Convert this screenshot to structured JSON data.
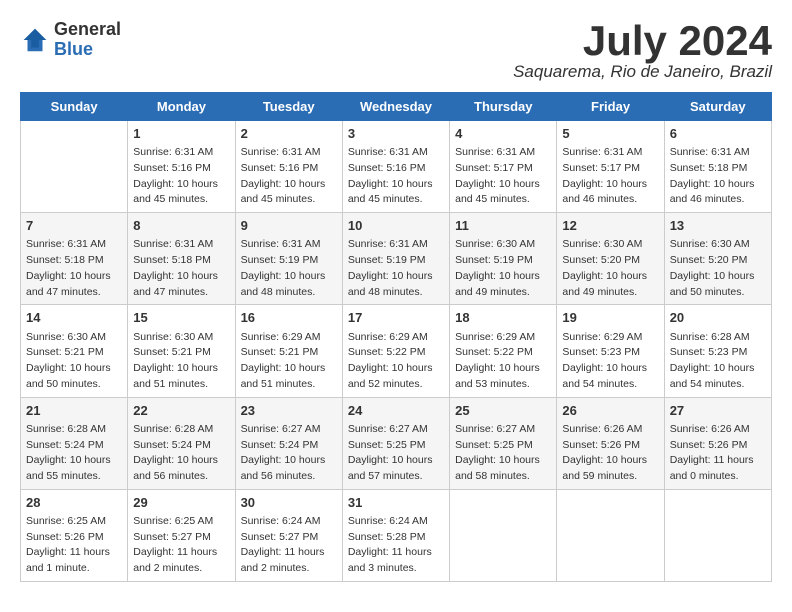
{
  "logo": {
    "general": "General",
    "blue": "Blue"
  },
  "title": "July 2024",
  "location": "Saquarema, Rio de Janeiro, Brazil",
  "days_of_week": [
    "Sunday",
    "Monday",
    "Tuesday",
    "Wednesday",
    "Thursday",
    "Friday",
    "Saturday"
  ],
  "weeks": [
    [
      {
        "day": "",
        "sunrise": "",
        "sunset": "",
        "daylight": ""
      },
      {
        "day": "1",
        "sunrise": "Sunrise: 6:31 AM",
        "sunset": "Sunset: 5:16 PM",
        "daylight": "Daylight: 10 hours and 45 minutes."
      },
      {
        "day": "2",
        "sunrise": "Sunrise: 6:31 AM",
        "sunset": "Sunset: 5:16 PM",
        "daylight": "Daylight: 10 hours and 45 minutes."
      },
      {
        "day": "3",
        "sunrise": "Sunrise: 6:31 AM",
        "sunset": "Sunset: 5:16 PM",
        "daylight": "Daylight: 10 hours and 45 minutes."
      },
      {
        "day": "4",
        "sunrise": "Sunrise: 6:31 AM",
        "sunset": "Sunset: 5:17 PM",
        "daylight": "Daylight: 10 hours and 45 minutes."
      },
      {
        "day": "5",
        "sunrise": "Sunrise: 6:31 AM",
        "sunset": "Sunset: 5:17 PM",
        "daylight": "Daylight: 10 hours and 46 minutes."
      },
      {
        "day": "6",
        "sunrise": "Sunrise: 6:31 AM",
        "sunset": "Sunset: 5:18 PM",
        "daylight": "Daylight: 10 hours and 46 minutes."
      }
    ],
    [
      {
        "day": "7",
        "sunrise": "Sunrise: 6:31 AM",
        "sunset": "Sunset: 5:18 PM",
        "daylight": "Daylight: 10 hours and 47 minutes."
      },
      {
        "day": "8",
        "sunrise": "Sunrise: 6:31 AM",
        "sunset": "Sunset: 5:18 PM",
        "daylight": "Daylight: 10 hours and 47 minutes."
      },
      {
        "day": "9",
        "sunrise": "Sunrise: 6:31 AM",
        "sunset": "Sunset: 5:19 PM",
        "daylight": "Daylight: 10 hours and 48 minutes."
      },
      {
        "day": "10",
        "sunrise": "Sunrise: 6:31 AM",
        "sunset": "Sunset: 5:19 PM",
        "daylight": "Daylight: 10 hours and 48 minutes."
      },
      {
        "day": "11",
        "sunrise": "Sunrise: 6:30 AM",
        "sunset": "Sunset: 5:19 PM",
        "daylight": "Daylight: 10 hours and 49 minutes."
      },
      {
        "day": "12",
        "sunrise": "Sunrise: 6:30 AM",
        "sunset": "Sunset: 5:20 PM",
        "daylight": "Daylight: 10 hours and 49 minutes."
      },
      {
        "day": "13",
        "sunrise": "Sunrise: 6:30 AM",
        "sunset": "Sunset: 5:20 PM",
        "daylight": "Daylight: 10 hours and 50 minutes."
      }
    ],
    [
      {
        "day": "14",
        "sunrise": "Sunrise: 6:30 AM",
        "sunset": "Sunset: 5:21 PM",
        "daylight": "Daylight: 10 hours and 50 minutes."
      },
      {
        "day": "15",
        "sunrise": "Sunrise: 6:30 AM",
        "sunset": "Sunset: 5:21 PM",
        "daylight": "Daylight: 10 hours and 51 minutes."
      },
      {
        "day": "16",
        "sunrise": "Sunrise: 6:29 AM",
        "sunset": "Sunset: 5:21 PM",
        "daylight": "Daylight: 10 hours and 51 minutes."
      },
      {
        "day": "17",
        "sunrise": "Sunrise: 6:29 AM",
        "sunset": "Sunset: 5:22 PM",
        "daylight": "Daylight: 10 hours and 52 minutes."
      },
      {
        "day": "18",
        "sunrise": "Sunrise: 6:29 AM",
        "sunset": "Sunset: 5:22 PM",
        "daylight": "Daylight: 10 hours and 53 minutes."
      },
      {
        "day": "19",
        "sunrise": "Sunrise: 6:29 AM",
        "sunset": "Sunset: 5:23 PM",
        "daylight": "Daylight: 10 hours and 54 minutes."
      },
      {
        "day": "20",
        "sunrise": "Sunrise: 6:28 AM",
        "sunset": "Sunset: 5:23 PM",
        "daylight": "Daylight: 10 hours and 54 minutes."
      }
    ],
    [
      {
        "day": "21",
        "sunrise": "Sunrise: 6:28 AM",
        "sunset": "Sunset: 5:24 PM",
        "daylight": "Daylight: 10 hours and 55 minutes."
      },
      {
        "day": "22",
        "sunrise": "Sunrise: 6:28 AM",
        "sunset": "Sunset: 5:24 PM",
        "daylight": "Daylight: 10 hours and 56 minutes."
      },
      {
        "day": "23",
        "sunrise": "Sunrise: 6:27 AM",
        "sunset": "Sunset: 5:24 PM",
        "daylight": "Daylight: 10 hours and 56 minutes."
      },
      {
        "day": "24",
        "sunrise": "Sunrise: 6:27 AM",
        "sunset": "Sunset: 5:25 PM",
        "daylight": "Daylight: 10 hours and 57 minutes."
      },
      {
        "day": "25",
        "sunrise": "Sunrise: 6:27 AM",
        "sunset": "Sunset: 5:25 PM",
        "daylight": "Daylight: 10 hours and 58 minutes."
      },
      {
        "day": "26",
        "sunrise": "Sunrise: 6:26 AM",
        "sunset": "Sunset: 5:26 PM",
        "daylight": "Daylight: 10 hours and 59 minutes."
      },
      {
        "day": "27",
        "sunrise": "Sunrise: 6:26 AM",
        "sunset": "Sunset: 5:26 PM",
        "daylight": "Daylight: 11 hours and 0 minutes."
      }
    ],
    [
      {
        "day": "28",
        "sunrise": "Sunrise: 6:25 AM",
        "sunset": "Sunset: 5:26 PM",
        "daylight": "Daylight: 11 hours and 1 minute."
      },
      {
        "day": "29",
        "sunrise": "Sunrise: 6:25 AM",
        "sunset": "Sunset: 5:27 PM",
        "daylight": "Daylight: 11 hours and 2 minutes."
      },
      {
        "day": "30",
        "sunrise": "Sunrise: 6:24 AM",
        "sunset": "Sunset: 5:27 PM",
        "daylight": "Daylight: 11 hours and 2 minutes."
      },
      {
        "day": "31",
        "sunrise": "Sunrise: 6:24 AM",
        "sunset": "Sunset: 5:28 PM",
        "daylight": "Daylight: 11 hours and 3 minutes."
      },
      {
        "day": "",
        "sunrise": "",
        "sunset": "",
        "daylight": ""
      },
      {
        "day": "",
        "sunrise": "",
        "sunset": "",
        "daylight": ""
      },
      {
        "day": "",
        "sunrise": "",
        "sunset": "",
        "daylight": ""
      }
    ]
  ]
}
